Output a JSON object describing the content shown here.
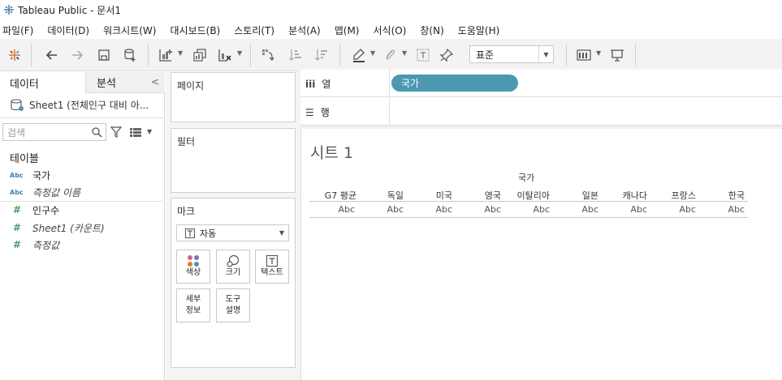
{
  "window": {
    "title": "Tableau Public - 문서1"
  },
  "menu": [
    "파일(F)",
    "데이터(D)",
    "워크시트(W)",
    "대시보드(B)",
    "스토리(T)",
    "분석(A)",
    "맵(M)",
    "서식(O)",
    "창(N)",
    "도움말(H)"
  ],
  "toolbar": {
    "fit_select": "표준"
  },
  "datapane": {
    "tab_data": "데이터",
    "tab_analysis": "분석",
    "source": "Sheet1 (전체인구 대비 아...",
    "search_placeholder": "검색",
    "section_title": "테이블",
    "type_abc": "Abc",
    "type_num": "#",
    "dimensions": [
      "국가",
      "측정값 이름"
    ],
    "measures": [
      "인구수",
      "Sheet1 (카운트)",
      "측정값"
    ]
  },
  "shelves": {
    "pages": "페이지",
    "filters": "필터",
    "marks": "마크",
    "mark_type": "자동",
    "mark_buttons": {
      "color": "색상",
      "size": "크기",
      "text": "텍스트",
      "detail": "세부\n정보",
      "tooltip": "도구\n설명"
    },
    "columns_label": "열",
    "rows_label": "행",
    "columns_pill": "국가"
  },
  "view": {
    "sheet_title": "시트 1",
    "header_field": "국가",
    "columns": [
      "G7 평균",
      "독일",
      "미국",
      "영국",
      "이탈리아",
      "일본",
      "캐나다",
      "프랑스",
      "한국"
    ],
    "cell_value": "Abc"
  }
}
